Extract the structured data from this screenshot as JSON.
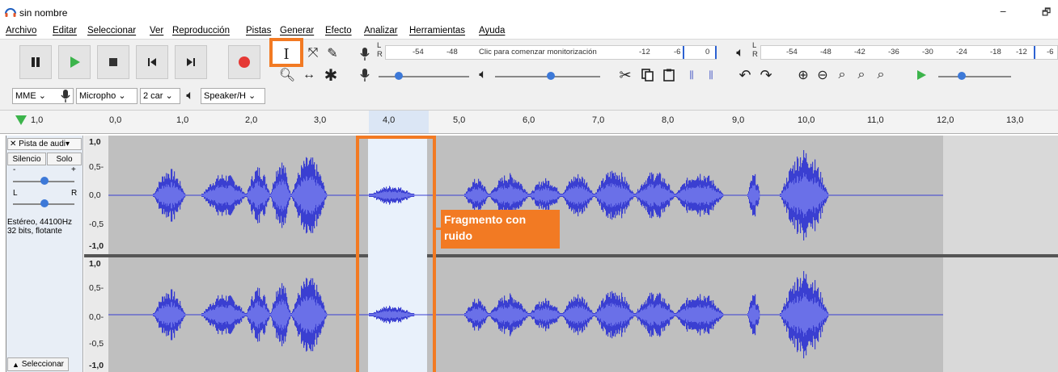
{
  "window": {
    "title": "sin nombre",
    "minimize_glyph": "−",
    "restore_glyph": "🗗"
  },
  "menu": [
    "Archivo",
    "Editar",
    "Seleccionar",
    "Ver",
    "Reproducción",
    "Pistas",
    "Generar",
    "Efecto",
    "Analizar",
    "Herramientas",
    "Ayuda"
  ],
  "meters": {
    "record_scale": [
      "-54",
      "-48",
      "-12",
      "-6",
      "0"
    ],
    "monitor_prompt": "Clic para comenzar monitorización",
    "playback_scale": [
      "-54",
      "-48",
      "-42",
      "-36",
      "-30",
      "-24",
      "-18",
      "-12",
      "-6"
    ],
    "lr_top": "L",
    "lr_bottom": "R"
  },
  "devices": {
    "host": "MME",
    "input": "Micropho",
    "channels": "2 car",
    "output": "Speaker/H"
  },
  "ruler": {
    "start": "1,0",
    "ticks": [
      "0,0",
      "1,0",
      "2,0",
      "3,0",
      "4,0",
      "5,0",
      "6,0",
      "7,0",
      "8,0",
      "9,0",
      "10,0",
      "11,0",
      "12,0",
      "13,0"
    ]
  },
  "track": {
    "name": "Pista de audi",
    "mute_label": "Silencio",
    "solo_label": "Solo",
    "gain_minus": "-",
    "gain_plus": "+",
    "pan_left": "L",
    "pan_right": "R",
    "info_line1": "Estéreo, 44100Hz",
    "info_line2": "32 bits, flotante",
    "select_label": "Seleccionar",
    "scale_top": [
      "1,0",
      "0,5-",
      "0,0",
      "-0,5",
      "-1,0"
    ],
    "scale_bottom": [
      "1,0",
      "0,5-",
      "0,0-",
      "-0,5",
      "-1,0"
    ]
  },
  "annotation": {
    "line1": "Fragmento con",
    "line2": "ruido",
    "color": "#f27a23"
  },
  "colors": {
    "waveform": "#3a3fd1",
    "waveform_rms": "#6a70e8",
    "selection": "#e9f1fb",
    "track_bg": "#bfbfbf",
    "accent": "#f27a23"
  }
}
